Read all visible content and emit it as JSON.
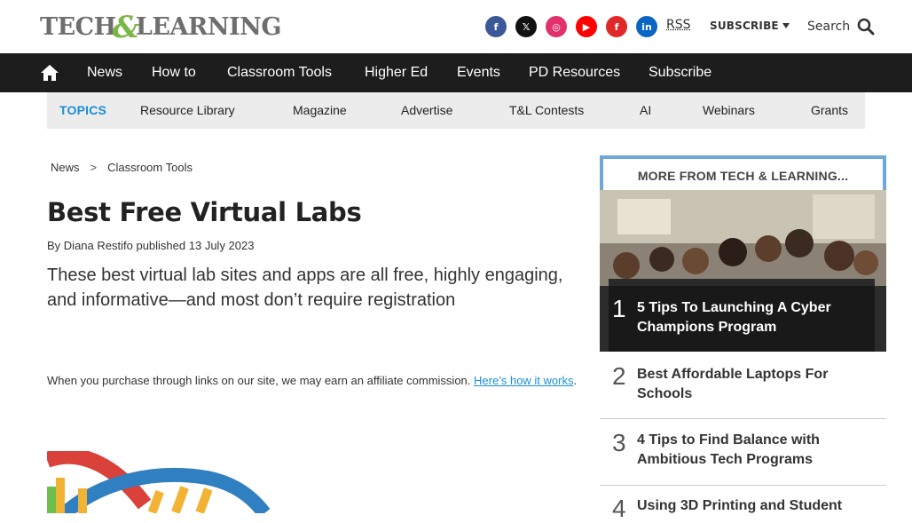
{
  "brand": {
    "logo_left": "TECH",
    "logo_amp": "&",
    "logo_right": "LEARNING"
  },
  "header": {
    "social": [
      {
        "name": "facebook-icon",
        "glyph": "f",
        "color": "#3b5998"
      },
      {
        "name": "x-icon",
        "glyph": "𝕏",
        "color": "#111111"
      },
      {
        "name": "instagram-icon",
        "glyph": "◎",
        "color": "#e1306c"
      },
      {
        "name": "youtube-icon",
        "glyph": "▶",
        "color": "#ff0000"
      },
      {
        "name": "flipboard-icon",
        "glyph": "f",
        "color": "#e12828"
      },
      {
        "name": "linkedin-icon",
        "glyph": "in",
        "color": "#0a66c2"
      }
    ],
    "rss": "RSS",
    "subscribe": "SUBSCRIBE",
    "search": "Search"
  },
  "nav": {
    "items": [
      "News",
      "How to",
      "Classroom Tools",
      "Higher Ed",
      "Events",
      "PD Resources",
      "Subscribe"
    ]
  },
  "topics": {
    "items": [
      "TOPICS",
      "Resource Library",
      "Magazine",
      "Advertise",
      "T&L Contests",
      "AI",
      "Webinars",
      "Grants"
    ]
  },
  "breadcrumb": {
    "items": [
      "News",
      "Classroom Tools"
    ],
    "sep": ">"
  },
  "article": {
    "title": "Best Free Virtual Labs",
    "byline_prefix": "By",
    "author": "Diana Restifo",
    "published": "published",
    "date": "13 July 2023",
    "strapline": "These best virtual lab sites and apps are all free, highly engaging, and informative—and most don’t require registration",
    "affiliate_text": "When you purchase through links on our site, we may earn an affiliate commission.",
    "affiliate_link": "Here’s how it works",
    "affiliate_end": "."
  },
  "sidebar": {
    "heading": "MORE FROM TECH & LEARNING...",
    "items": [
      {
        "num": "1",
        "title": "5 Tips To Launching A Cyber Champions Program"
      },
      {
        "num": "2",
        "title": "Best Affordable Laptops For Schools"
      },
      {
        "num": "3",
        "title": "4 Tips to Find Balance with Ambitious Tech Programs"
      },
      {
        "num": "4",
        "title": "Using 3D Printing and Student"
      }
    ]
  }
}
